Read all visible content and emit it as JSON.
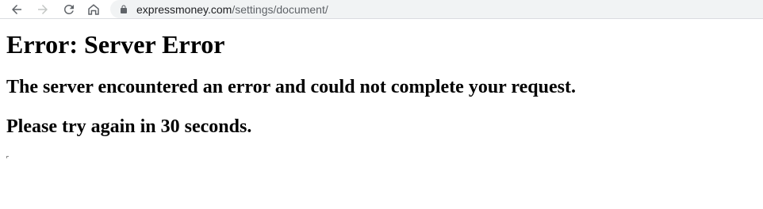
{
  "browser": {
    "url_host": "expressmoney.com",
    "url_path": "/settings/document/",
    "icons": {
      "back": "arrow-left-icon",
      "forward": "arrow-right-icon",
      "reload": "reload-icon",
      "home": "home-icon",
      "lock": "lock-icon"
    }
  },
  "page": {
    "title": "Error: Server Error",
    "message": "The server encountered an error and could not complete your request.",
    "retry": "Please try again in 30 seconds."
  },
  "colors": {
    "omnibox_bg": "#f1f3f4",
    "icon_active": "#5f6368",
    "icon_disabled": "#c4c7c5",
    "text": "#000000"
  }
}
